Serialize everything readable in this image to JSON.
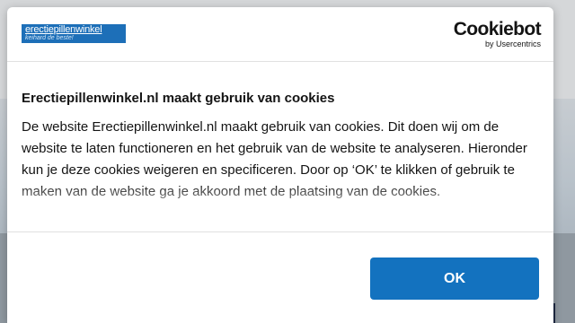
{
  "site": {
    "logo_name": "erectiepillenwinkel",
    "logo_tagline": "keihard de beste!"
  },
  "cookiebot": {
    "brand": "Cookiebot",
    "sub": "by Usercentrics"
  },
  "dialog": {
    "title": "Erectiepillenwinkel.nl maakt gebruik van cookies",
    "body": "De website Erectiepillenwinkel.nl maakt gebruik van cookies. Dit doen wij om de website te laten functioneren en het gebruik van de website te analyseren. Hieronder kun je deze cookies weigeren en specificeren. Door op ‘OK’ te klikken of gebruik te maken van de website ga je akkoord met de plaatsing van de cookies.",
    "ok_label": "OK"
  },
  "colors": {
    "accent": "#1372bf",
    "logo_bg": "#1d6fb8"
  }
}
